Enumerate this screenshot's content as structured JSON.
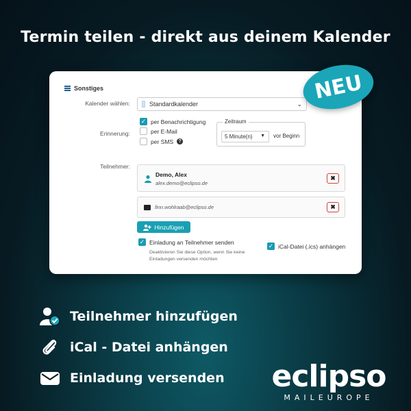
{
  "headline": "Termin teilen - direkt aus deinem Kalender",
  "badge": "NEU",
  "section_title": "Sonstiges",
  "form": {
    "calendar_label": "Kalender wählen:",
    "calendar_value": "Standardkalender",
    "reminder_label": "Erinnerung:",
    "reminder_options": [
      {
        "label": "per Benachrichtigung",
        "checked": true
      },
      {
        "label": "per E-Mail",
        "checked": false
      },
      {
        "label": "per SMS",
        "checked": false
      }
    ],
    "timeframe_legend": "Zeitraum",
    "timeframe_value": "5 Minute(n)",
    "timeframe_suffix": "vor Beginn",
    "participants_label": "Teilnehmer:",
    "participants": [
      {
        "name": "Demo, Alex",
        "email": "alex.demo@eclipso.de"
      },
      {
        "name": "",
        "email": "finn.wohlraab@eclipso.de"
      }
    ],
    "remove_label": "✖",
    "add_button": "Hinzufügen",
    "send_invite_label": "Einladung an Teilnehmer senden",
    "send_invite_note": "Deaktivieren Sie diese Option, wenn Sie keine Einladungen versenden möchten",
    "ical_label": "iCal-Datei (.ics) anhängen"
  },
  "features": [
    {
      "icon": "person-check-icon",
      "label": "Teilnehmer hinzufügen"
    },
    {
      "icon": "paperclip-icon",
      "label": "iCal - Datei anhängen"
    },
    {
      "icon": "envelope-icon",
      "label": "Einladung versenden"
    }
  ],
  "logo": {
    "name": "eclipso",
    "tagline": "MAILEUROPE"
  },
  "colors": {
    "accent": "#1aa6b8",
    "remove_border": "#d04040"
  }
}
